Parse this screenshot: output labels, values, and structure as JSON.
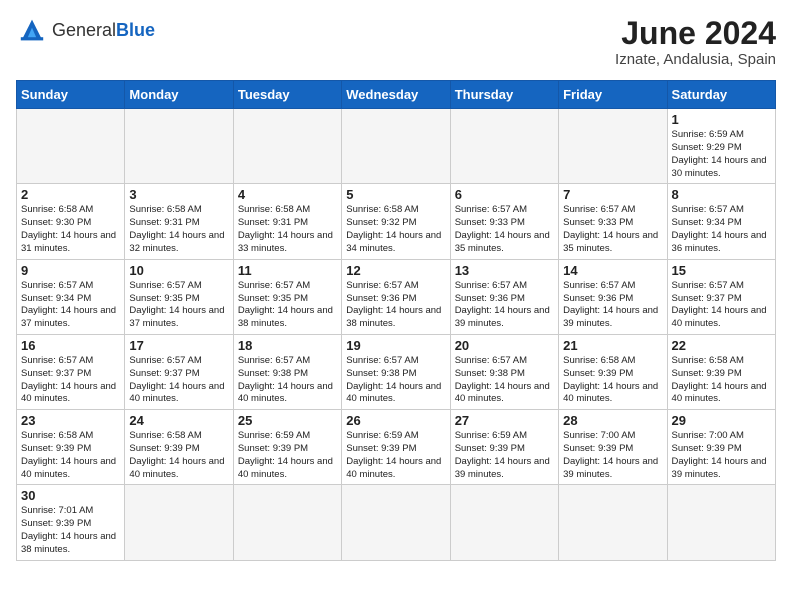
{
  "header": {
    "logo_general": "General",
    "logo_blue": "Blue",
    "month_title": "June 2024",
    "location": "Iznate, Andalusia, Spain"
  },
  "weekdays": [
    "Sunday",
    "Monday",
    "Tuesday",
    "Wednesday",
    "Thursday",
    "Friday",
    "Saturday"
  ],
  "days": [
    {
      "num": "",
      "info": ""
    },
    {
      "num": "",
      "info": ""
    },
    {
      "num": "",
      "info": ""
    },
    {
      "num": "",
      "info": ""
    },
    {
      "num": "",
      "info": ""
    },
    {
      "num": "",
      "info": ""
    },
    {
      "num": "1",
      "info": "Sunrise: 6:59 AM\nSunset: 9:29 PM\nDaylight: 14 hours and 30 minutes."
    },
    {
      "num": "2",
      "info": "Sunrise: 6:58 AM\nSunset: 9:30 PM\nDaylight: 14 hours and 31 minutes."
    },
    {
      "num": "3",
      "info": "Sunrise: 6:58 AM\nSunset: 9:31 PM\nDaylight: 14 hours and 32 minutes."
    },
    {
      "num": "4",
      "info": "Sunrise: 6:58 AM\nSunset: 9:31 PM\nDaylight: 14 hours and 33 minutes."
    },
    {
      "num": "5",
      "info": "Sunrise: 6:58 AM\nSunset: 9:32 PM\nDaylight: 14 hours and 34 minutes."
    },
    {
      "num": "6",
      "info": "Sunrise: 6:57 AM\nSunset: 9:33 PM\nDaylight: 14 hours and 35 minutes."
    },
    {
      "num": "7",
      "info": "Sunrise: 6:57 AM\nSunset: 9:33 PM\nDaylight: 14 hours and 35 minutes."
    },
    {
      "num": "8",
      "info": "Sunrise: 6:57 AM\nSunset: 9:34 PM\nDaylight: 14 hours and 36 minutes."
    },
    {
      "num": "9",
      "info": "Sunrise: 6:57 AM\nSunset: 9:34 PM\nDaylight: 14 hours and 37 minutes."
    },
    {
      "num": "10",
      "info": "Sunrise: 6:57 AM\nSunset: 9:35 PM\nDaylight: 14 hours and 37 minutes."
    },
    {
      "num": "11",
      "info": "Sunrise: 6:57 AM\nSunset: 9:35 PM\nDaylight: 14 hours and 38 minutes."
    },
    {
      "num": "12",
      "info": "Sunrise: 6:57 AM\nSunset: 9:36 PM\nDaylight: 14 hours and 38 minutes."
    },
    {
      "num": "13",
      "info": "Sunrise: 6:57 AM\nSunset: 9:36 PM\nDaylight: 14 hours and 39 minutes."
    },
    {
      "num": "14",
      "info": "Sunrise: 6:57 AM\nSunset: 9:36 PM\nDaylight: 14 hours and 39 minutes."
    },
    {
      "num": "15",
      "info": "Sunrise: 6:57 AM\nSunset: 9:37 PM\nDaylight: 14 hours and 40 minutes."
    },
    {
      "num": "16",
      "info": "Sunrise: 6:57 AM\nSunset: 9:37 PM\nDaylight: 14 hours and 40 minutes."
    },
    {
      "num": "17",
      "info": "Sunrise: 6:57 AM\nSunset: 9:37 PM\nDaylight: 14 hours and 40 minutes."
    },
    {
      "num": "18",
      "info": "Sunrise: 6:57 AM\nSunset: 9:38 PM\nDaylight: 14 hours and 40 minutes."
    },
    {
      "num": "19",
      "info": "Sunrise: 6:57 AM\nSunset: 9:38 PM\nDaylight: 14 hours and 40 minutes."
    },
    {
      "num": "20",
      "info": "Sunrise: 6:57 AM\nSunset: 9:38 PM\nDaylight: 14 hours and 40 minutes."
    },
    {
      "num": "21",
      "info": "Sunrise: 6:58 AM\nSunset: 9:39 PM\nDaylight: 14 hours and 40 minutes."
    },
    {
      "num": "22",
      "info": "Sunrise: 6:58 AM\nSunset: 9:39 PM\nDaylight: 14 hours and 40 minutes."
    },
    {
      "num": "23",
      "info": "Sunrise: 6:58 AM\nSunset: 9:39 PM\nDaylight: 14 hours and 40 minutes."
    },
    {
      "num": "24",
      "info": "Sunrise: 6:58 AM\nSunset: 9:39 PM\nDaylight: 14 hours and 40 minutes."
    },
    {
      "num": "25",
      "info": "Sunrise: 6:59 AM\nSunset: 9:39 PM\nDaylight: 14 hours and 40 minutes."
    },
    {
      "num": "26",
      "info": "Sunrise: 6:59 AM\nSunset: 9:39 PM\nDaylight: 14 hours and 40 minutes."
    },
    {
      "num": "27",
      "info": "Sunrise: 6:59 AM\nSunset: 9:39 PM\nDaylight: 14 hours and 39 minutes."
    },
    {
      "num": "28",
      "info": "Sunrise: 7:00 AM\nSunset: 9:39 PM\nDaylight: 14 hours and 39 minutes."
    },
    {
      "num": "29",
      "info": "Sunrise: 7:00 AM\nSunset: 9:39 PM\nDaylight: 14 hours and 39 minutes."
    },
    {
      "num": "30",
      "info": "Sunrise: 7:01 AM\nSunset: 9:39 PM\nDaylight: 14 hours and 38 minutes."
    },
    {
      "num": "",
      "info": ""
    },
    {
      "num": "",
      "info": ""
    },
    {
      "num": "",
      "info": ""
    },
    {
      "num": "",
      "info": ""
    },
    {
      "num": "",
      "info": ""
    },
    {
      "num": "",
      "info": ""
    }
  ]
}
